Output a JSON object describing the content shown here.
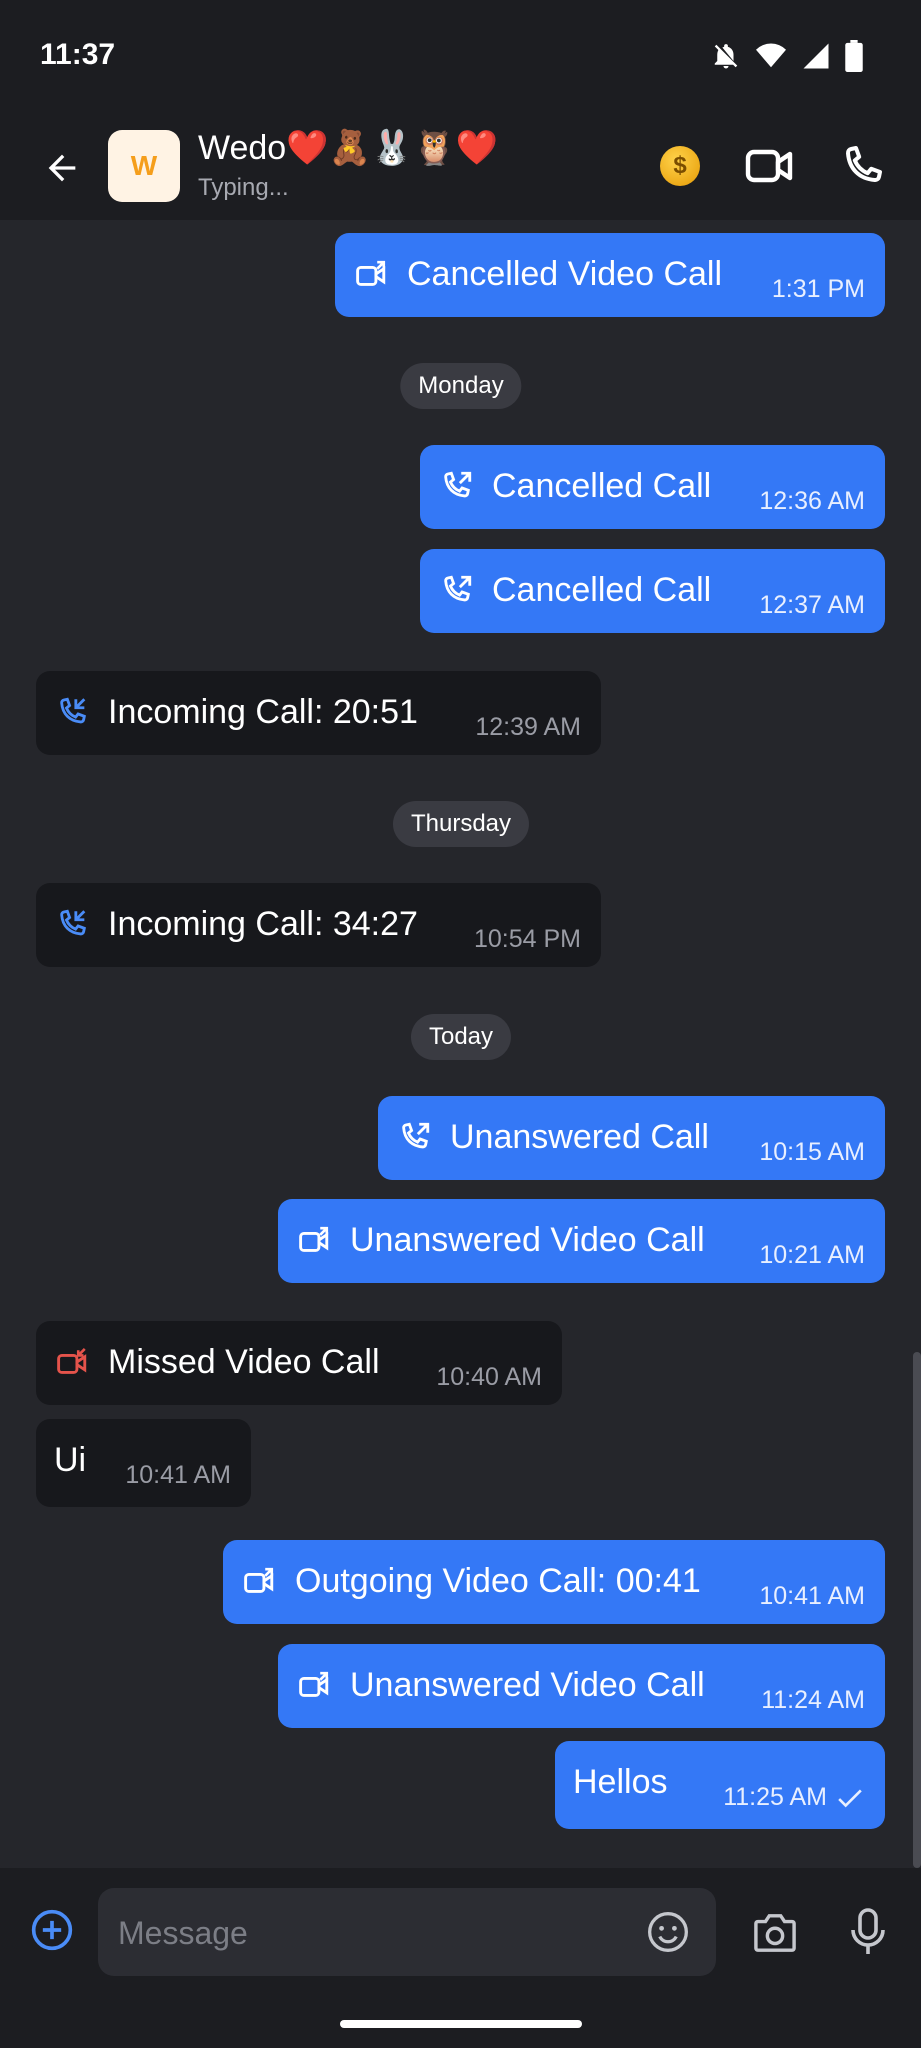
{
  "status_bar": {
    "time": "11:37"
  },
  "header": {
    "avatar_letter": "W",
    "contact_name": "Wedo❤️🧸🐰🦉❤️",
    "status": "Typing..."
  },
  "dates": {
    "monday": "Monday",
    "thursday": "Thursday",
    "today": "Today"
  },
  "messages": [
    {
      "text": "Cancelled Video Call",
      "time": "1:31 PM",
      "dir": "out",
      "icon": "video-call-icon"
    },
    {
      "text": "Cancelled Call",
      "time": "12:36 AM",
      "dir": "out",
      "icon": "outgoing-call-icon"
    },
    {
      "text": "Cancelled Call",
      "time": "12:37 AM",
      "dir": "out",
      "icon": "outgoing-call-icon"
    },
    {
      "text": "Incoming Call: 20:51",
      "time": "12:39 AM",
      "dir": "in",
      "icon": "incoming-call-icon"
    },
    {
      "text": "Incoming Call: 34:27",
      "time": "10:54 PM",
      "dir": "in",
      "icon": "incoming-call-icon"
    },
    {
      "text": "Unanswered Call",
      "time": "10:15 AM",
      "dir": "out",
      "icon": "outgoing-call-icon"
    },
    {
      "text": "Unanswered Video Call",
      "time": "10:21 AM",
      "dir": "out",
      "icon": "video-call-icon"
    },
    {
      "text": "Missed Video Call",
      "time": "10:40 AM",
      "dir": "in",
      "icon": "missed-video-call-icon"
    },
    {
      "text": "Ui",
      "time": "10:41 AM",
      "dir": "in",
      "icon": ""
    },
    {
      "text": "Outgoing Video Call: 00:41",
      "time": "10:41 AM",
      "dir": "out",
      "icon": "video-call-icon"
    },
    {
      "text": "Unanswered Video Call",
      "time": "11:24 AM",
      "dir": "out",
      "icon": "video-call-icon"
    },
    {
      "text": "Hellos",
      "time": "11:25 AM",
      "dir": "out",
      "icon": "",
      "status": "sent"
    }
  ],
  "composer": {
    "placeholder": "Message"
  },
  "colors": {
    "background": "#25262b",
    "bar": "#1c1d21",
    "outgoing_bubble": "#3478f6",
    "incoming_bubble": "#17181c",
    "incoming_icon": "#4a8cf7",
    "missed_icon": "#e5534b"
  }
}
